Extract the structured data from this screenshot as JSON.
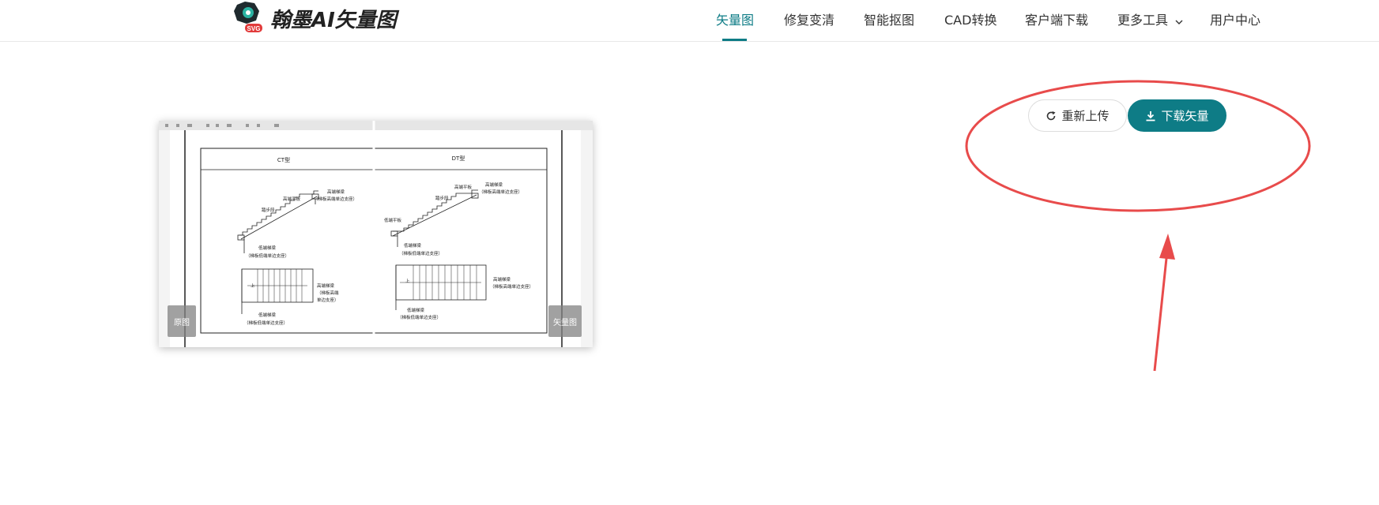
{
  "brand": {
    "name": "翰墨AI矢量图",
    "mark_label": "SVG",
    "colors": {
      "accent": "#0e7c86",
      "logo_dark": "#1f2a2e",
      "logo_red": "#e23b3b",
      "annotation": "#e84b4b"
    }
  },
  "nav": {
    "items": [
      {
        "label": "矢量图",
        "active": true
      },
      {
        "label": "修复变清",
        "active": false
      },
      {
        "label": "智能抠图",
        "active": false
      },
      {
        "label": "CAD转换",
        "active": false
      },
      {
        "label": "客户端下载",
        "active": false
      },
      {
        "label": "更多工具",
        "active": false,
        "dropdown": true
      },
      {
        "label": "用户中心",
        "active": false
      }
    ]
  },
  "preview": {
    "left_badge": "原图",
    "right_badge": "矢量图",
    "drawing": {
      "left_title": "CT型",
      "right_title": "DT型",
      "labels_left": [
        "高端梯梁",
        "（梯板高端单边支座）",
        "高端平板",
        "踏步段",
        "低端梯梁",
        "（梯板低端单边支座）",
        "高端梯梁",
        "（梯板高端",
        "单边支座）",
        "低端梯梁",
        "（梯板低端单边支座）",
        "上"
      ],
      "labels_right": [
        "高端梯梁",
        "（梯板高端单边支座）",
        "高端平板",
        "踏步段",
        "低端平板",
        "低端梯梁",
        "（梯板低端单边支座）",
        "高端梯梁",
        "（梯板高端单边支座）",
        "低端梯梁",
        "（梯板低端单边支座）",
        "上"
      ]
    }
  },
  "actions": {
    "reupload_label": "重新上传",
    "download_label": "下载矢量"
  }
}
